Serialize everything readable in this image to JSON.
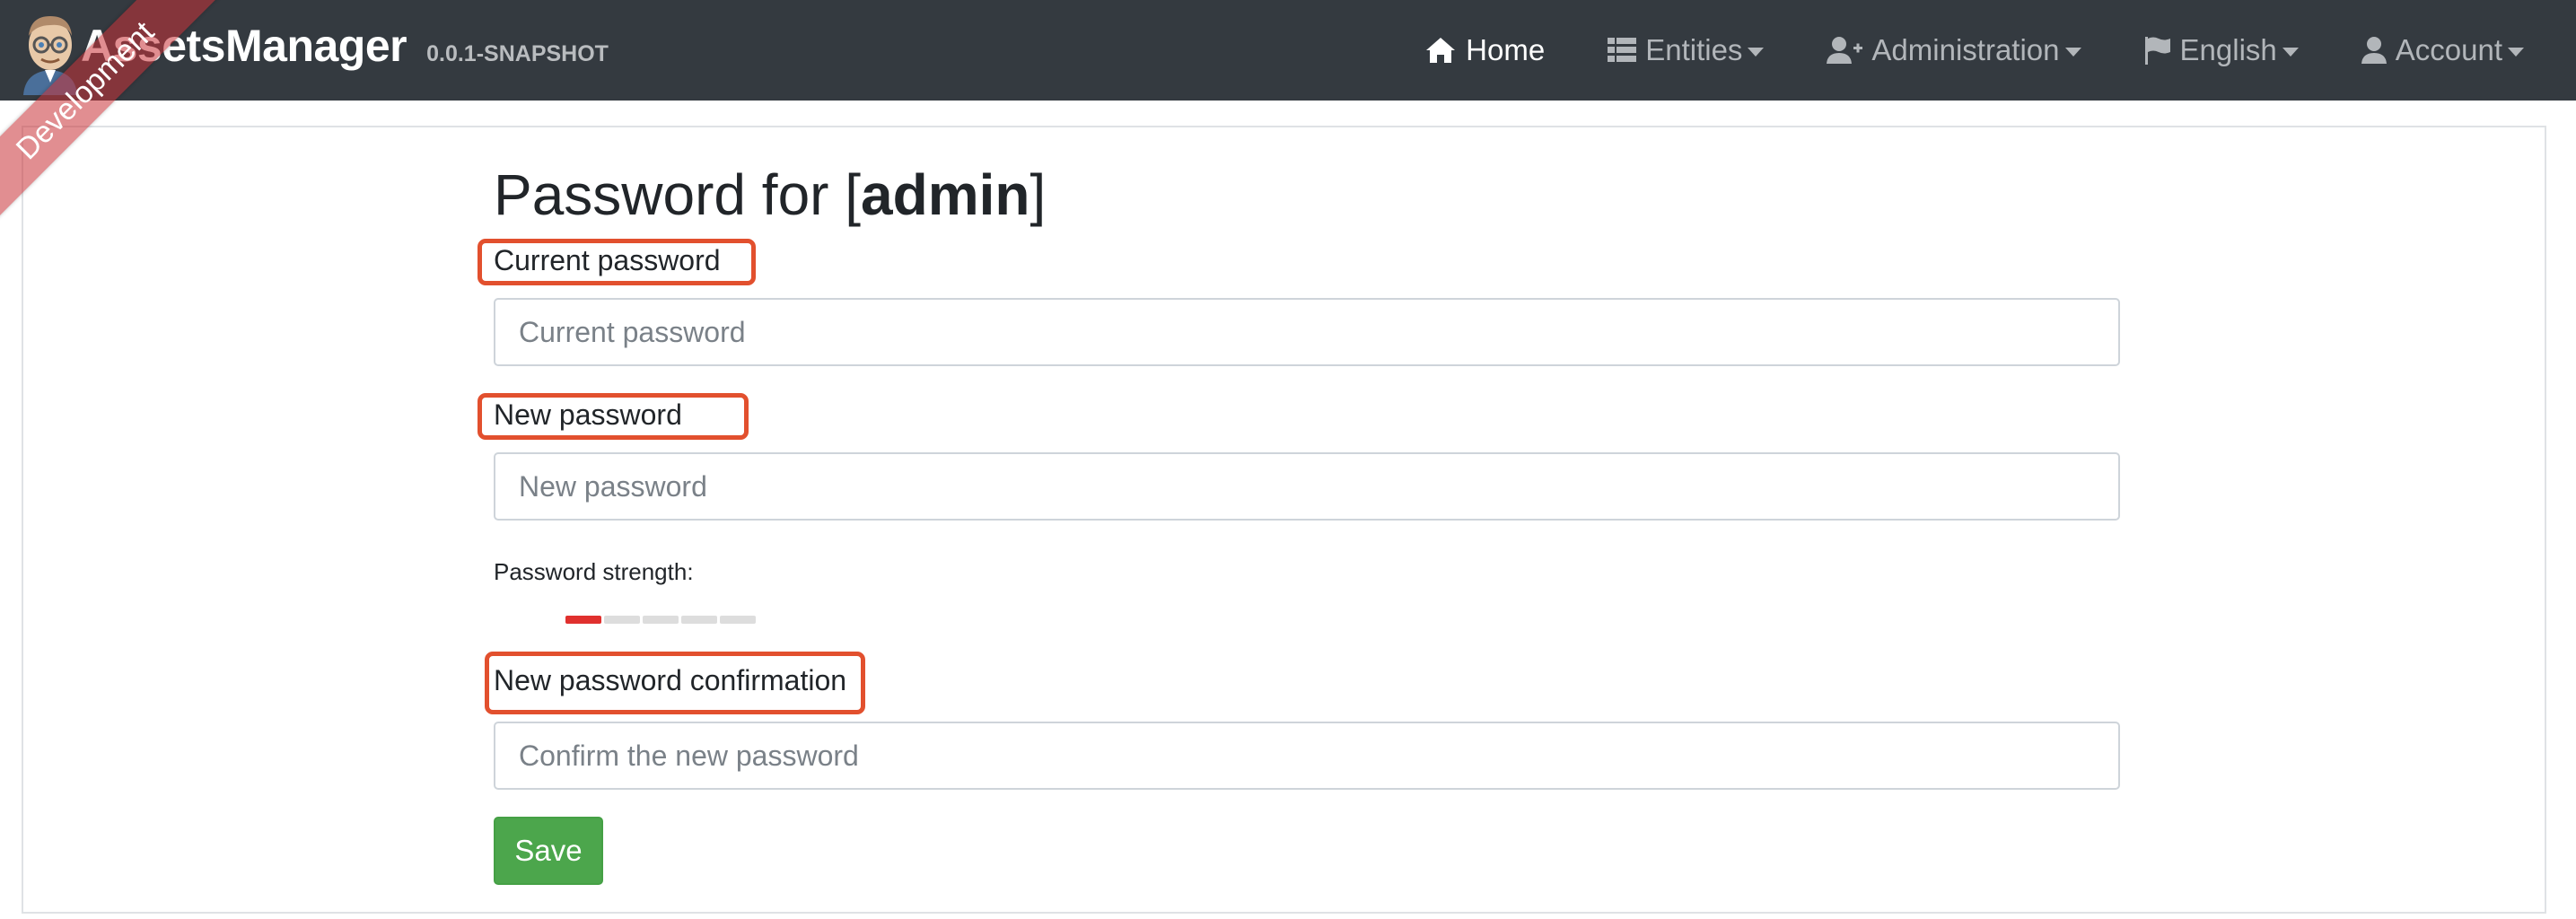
{
  "navbar": {
    "brand": "AssetsManager",
    "version": "0.0.1-SNAPSHOT",
    "ribbon": "Development",
    "items": [
      {
        "label": "Home",
        "icon": "home-icon",
        "active": true
      },
      {
        "label": "Entities",
        "icon": "list-icon",
        "dropdown": true
      },
      {
        "label": "Administration",
        "icon": "user-plus-icon",
        "dropdown": true
      },
      {
        "label": "English",
        "icon": "flag-icon",
        "dropdown": true
      },
      {
        "label": "Account",
        "icon": "user-icon",
        "dropdown": true
      }
    ]
  },
  "page": {
    "title_prefix": "Password for [",
    "username": "admin",
    "title_suffix": "]"
  },
  "form": {
    "current_password": {
      "label": "Current password",
      "placeholder": "Current password",
      "value": ""
    },
    "new_password": {
      "label": "New password",
      "placeholder": "New password",
      "value": ""
    },
    "strength_label": "Password strength:",
    "strength": {
      "level": 1,
      "max": 5,
      "color": "#e0302e",
      "empty_color": "#dddddd"
    },
    "confirm_password": {
      "label": "New password confirmation",
      "placeholder": "Confirm the new password",
      "value": ""
    },
    "save_label": "Save"
  },
  "colors": {
    "navbar_bg": "#343a40",
    "highlight": "#e2502e",
    "save_bg": "#4ca64c"
  }
}
